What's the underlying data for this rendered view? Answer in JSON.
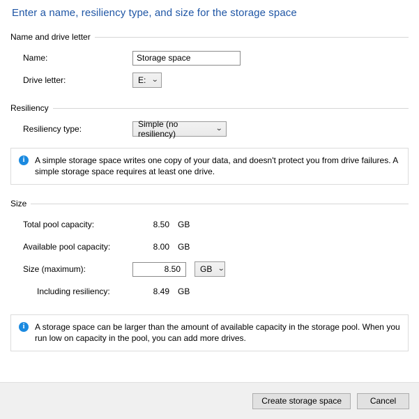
{
  "title": "Enter a name, resiliency type, and size for the storage space",
  "sections": {
    "name_and_drive": {
      "header": "Name and drive letter",
      "name_label": "Name:",
      "name_value": "Storage space",
      "name_placeholder": "",
      "drive_letter_label": "Drive letter:",
      "drive_letter_value": "E:"
    },
    "resiliency": {
      "header": "Resiliency",
      "type_label": "Resiliency type:",
      "type_value": "Simple (no resiliency)",
      "info": "A simple storage space writes one copy of your data, and doesn't protect you from drive failures. A simple storage space requires at least one drive."
    },
    "size": {
      "header": "Size",
      "total_pool_label": "Total pool capacity:",
      "total_pool_value": "8.50",
      "total_pool_unit": "GB",
      "available_pool_label": "Available pool capacity:",
      "available_pool_value": "8.00",
      "available_pool_unit": "GB",
      "size_max_label": "Size (maximum):",
      "size_max_value": "8.50",
      "size_unit_value": "GB",
      "including_resiliency_label": "Including resiliency:",
      "including_resiliency_value": "8.49",
      "including_resiliency_unit": "GB",
      "info": "A storage space can be larger than the amount of available capacity in the storage pool. When you run low on capacity in the pool, you can add more drives."
    }
  },
  "footer": {
    "create_label": "Create storage space",
    "cancel_label": "Cancel"
  },
  "icons": {
    "info": "i",
    "chevron_down": "⌄"
  },
  "colors": {
    "title_blue": "#1f56a5",
    "info_icon_blue": "#1b8ae0",
    "footer_bg": "#f0f0f0"
  }
}
